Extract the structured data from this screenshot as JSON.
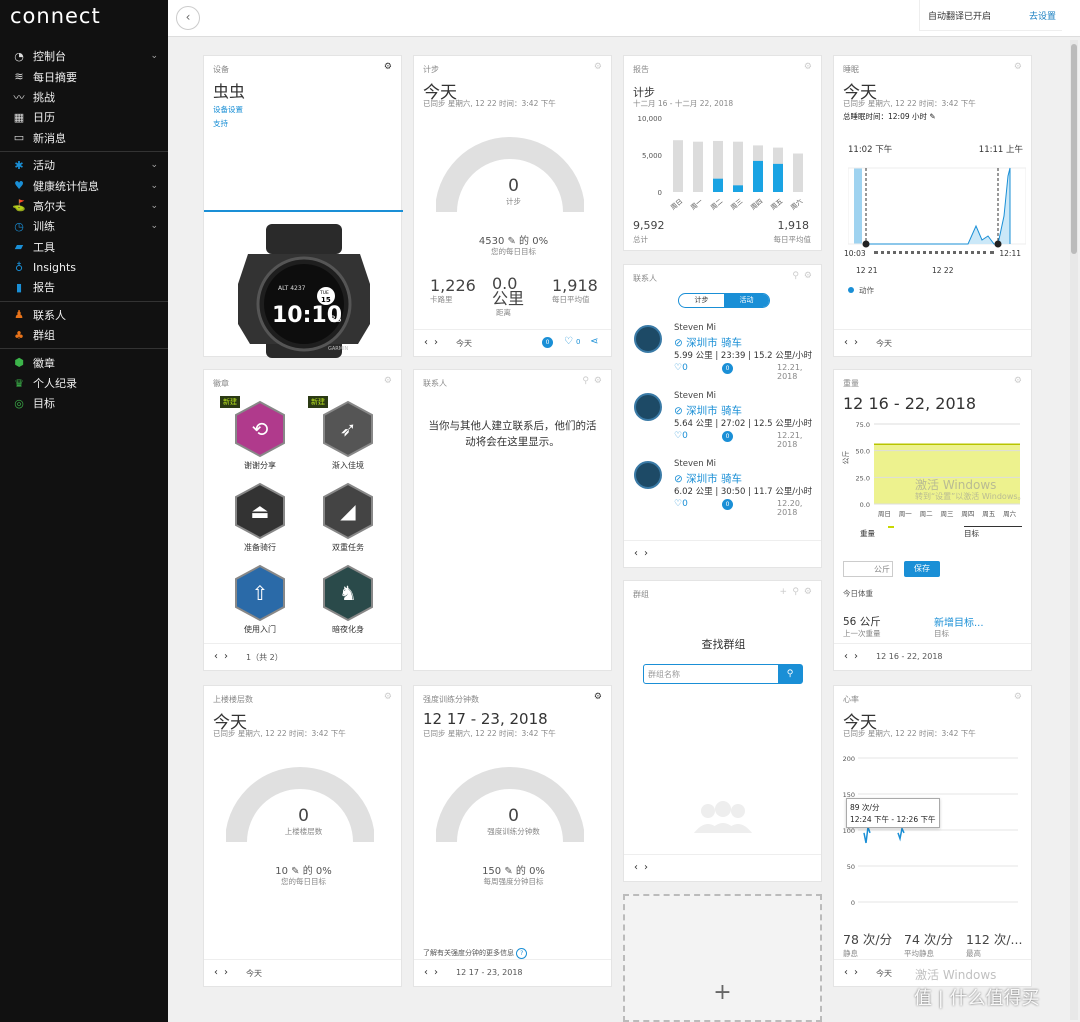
{
  "app": {
    "logo": "connect"
  },
  "sidebar": {
    "items": [
      {
        "label": "控制台",
        "icon": "dashboard-icon",
        "chevron": true
      },
      {
        "label": "每日摘要",
        "icon": "layers-icon",
        "chevron": false
      },
      {
        "label": "挑战",
        "icon": "challenge-icon",
        "chevron": false
      },
      {
        "label": "日历",
        "icon": "calendar-icon",
        "chevron": false
      },
      {
        "label": "新消息",
        "icon": "inbox-icon",
        "chevron": false
      },
      {
        "label": "活动",
        "icon": "activity-icon",
        "chevron": true
      },
      {
        "label": "健康统计信息",
        "icon": "heart-icon",
        "chevron": true
      },
      {
        "label": "高尔夫",
        "icon": "golf-icon",
        "chevron": true
      },
      {
        "label": "训练",
        "icon": "training-icon",
        "chevron": true
      },
      {
        "label": "工具",
        "icon": "shoe-icon",
        "chevron": false
      },
      {
        "label": "Insights",
        "icon": "bulb-icon",
        "chevron": false
      },
      {
        "label": "报告",
        "icon": "report-icon",
        "chevron": false
      },
      {
        "label": "联系人",
        "icon": "contacts-icon",
        "chevron": false
      },
      {
        "label": "群组",
        "icon": "groups-icon",
        "chevron": false
      },
      {
        "label": "徽章",
        "icon": "badge-icon",
        "chevron": false
      },
      {
        "label": "个人纪录",
        "icon": "trophy-icon",
        "chevron": false
      },
      {
        "label": "目标",
        "icon": "target-icon",
        "chevron": false
      }
    ]
  },
  "topbar": {
    "translate_text": "自动翻译已开启",
    "translate_link": "去设置"
  },
  "device": {
    "title": "设备",
    "name": "虫虫",
    "settings_link": "设备设置",
    "support_link": "支持",
    "watch": {
      "alt": "ALT 4237",
      "day": "TUE",
      "date": "15",
      "time": "10:10",
      "sec": "38",
      "brand": "GARMIN"
    }
  },
  "steps": {
    "title": "计步",
    "heading": "今天",
    "synced": "已同步 星期六, 12 22 时间：3:42 下午",
    "value": "0",
    "unit": "计步",
    "goal_text": "4530 ✎ 的 0%",
    "goal_label": "您的每日目标",
    "progress": 0,
    "stats": [
      {
        "value": "1,226",
        "label": "卡路里"
      },
      {
        "value": "0.0 公里",
        "label": "距离"
      },
      {
        "value": "1,918",
        "label": "每日平均值"
      }
    ],
    "footer": "今天",
    "comments": "0",
    "likes": "0"
  },
  "report": {
    "title": "报告",
    "heading": "计步",
    "range": "十二月 16 - 十二月 22, 2018",
    "total_value": "9,592",
    "total_label": "总计",
    "avg_value": "1,918",
    "avg_label": "每日平均值",
    "chart_data": {
      "type": "bar",
      "categories": [
        "周日",
        "周一",
        "周二",
        "周三",
        "周四",
        "周五",
        "周六"
      ],
      "series": [
        {
          "values": [
            0,
            0,
            1800,
            900,
            4200,
            3800,
            0
          ]
        },
        {
          "values": [
            7000,
            6800,
            6900,
            6800,
            6300,
            6000,
            5200
          ]
        }
      ],
      "yticks": [
        "10,000",
        "5,000",
        "0"
      ],
      "ylim": [
        0,
        10000
      ],
      "colors": {
        "actual": "#1aa3e3",
        "goal": "#dcdcdc"
      }
    }
  },
  "sleep": {
    "title": "睡眠",
    "heading": "今天",
    "synced": "已同步 星期六, 12 22 时间：3:42 下午",
    "total": "总睡眠时间：12:09 小时 ✎",
    "start": "11:02 下午",
    "end": "11:11 上午",
    "axis_left": "10:03",
    "axis_right": "12:11",
    "date_left": "12 21",
    "date_right": "12 22",
    "legend": "动作",
    "footer": "今天"
  },
  "badges": {
    "title": "徽章",
    "items": [
      {
        "label": "谢谢分享",
        "new": "新建",
        "color": "#b03a8c",
        "icon": "share-icon"
      },
      {
        "label": "渐入佳境",
        "new": "新建",
        "color": "#555",
        "icon": "run-icon"
      },
      {
        "label": "准备骑行",
        "new": "",
        "color": "#333",
        "icon": "bike-seat-icon"
      },
      {
        "label": "双重任务",
        "new": "",
        "color": "#444",
        "icon": "shoe-icon"
      },
      {
        "label": "使用入门",
        "new": "",
        "color": "#2a6aa8",
        "icon": "arrow-up-icon"
      },
      {
        "label": "暗夜化身",
        "new": "",
        "color": "#2a4a4a",
        "icon": "wolf-icon"
      }
    ],
    "footer": "1（共 2）"
  },
  "contacts_empty": {
    "title": "联系人",
    "message": "当你与其他人建立联系后，他们的活动将会在这里显示。"
  },
  "contacts": {
    "title": "联系人",
    "tabs": [
      "计步",
      "活动"
    ],
    "rows": [
      {
        "name": "Steven Mi",
        "activity": "深圳市 骑车",
        "stats": "5.99 公里 | 23:39 | 15.2 公里/小时",
        "date": "12.21, 2018",
        "likes": "0",
        "comments": "0"
      },
      {
        "name": "Steven Mi",
        "activity": "深圳市 骑车",
        "stats": "5.64 公里 | 27:02 | 12.5 公里/小时",
        "date": "12.21, 2018",
        "likes": "0",
        "comments": "0"
      },
      {
        "name": "Steven Mi",
        "activity": "深圳市 骑车",
        "stats": "6.02 公里 | 30:50 | 11.7 公里/小时",
        "date": "12.20, 2018",
        "likes": "0",
        "comments": "0"
      }
    ]
  },
  "weight": {
    "title": "重量",
    "heading": "12 16 - 22, 2018",
    "yticks": [
      "75.0",
      "50.0",
      "25.0",
      "0.0"
    ],
    "ylabel": "公斤",
    "days": [
      "周日",
      "周一",
      "周二",
      "周三",
      "周四",
      "周五",
      "周六"
    ],
    "legend_weight": "重量",
    "legend_goal": "目标",
    "input_unit": "公斤",
    "save": "保存",
    "today_label": "今日体重",
    "last_value": "56 公斤",
    "last_label": "上一次重量",
    "goal_link": "新增目标...",
    "goal_label": "目标",
    "footer": "12 16 - 22, 2018",
    "goal_line": 56
  },
  "groups": {
    "title": "群组",
    "heading": "查找群组",
    "placeholder": "群组名称"
  },
  "floors": {
    "title": "上楼楼层数",
    "heading": "今天",
    "synced": "已同步 星期六, 12 22 时间：3:42 下午",
    "value": "0",
    "unit": "上楼楼层数",
    "goal_text": "10 ✎ 的 0%",
    "goal_label": "您的每日目标",
    "progress": 0,
    "footer": "今天"
  },
  "intensity": {
    "title": "强度训练分钟数",
    "heading": "12 17 - 23, 2018",
    "synced": "已同步 星期六, 12 22 时间：3:42 下午",
    "value": "0",
    "unit": "强度训练分钟数",
    "goal_text": "150 ✎ 的 0%",
    "goal_label": "每周强度分钟目标",
    "progress": 0,
    "learn_more": "了解有关强度分钟的更多信息",
    "footer": "12 17 - 23, 2018"
  },
  "heart": {
    "title": "心率",
    "heading": "今天",
    "synced": "已同步 星期六, 12 22 时间：3:42 下午",
    "yticks": [
      "200",
      "150",
      "100",
      "50",
      "0"
    ],
    "tooltip_value": "89 次/分",
    "tooltip_time": "12:24 下午 - 12:26 下午",
    "stats": [
      {
        "value": "78 次/分",
        "label": "静息"
      },
      {
        "value": "74 次/分",
        "label": "平均静息"
      },
      {
        "value": "112 次/...",
        "label": "最高"
      }
    ],
    "footer": "今天"
  },
  "add_card": {
    "icon": "plus-icon"
  },
  "watermark": {
    "text": "激活 Windows",
    "subtext": "转到“设置”以激活 Windows。",
    "site": "值 | 什么值得买"
  }
}
